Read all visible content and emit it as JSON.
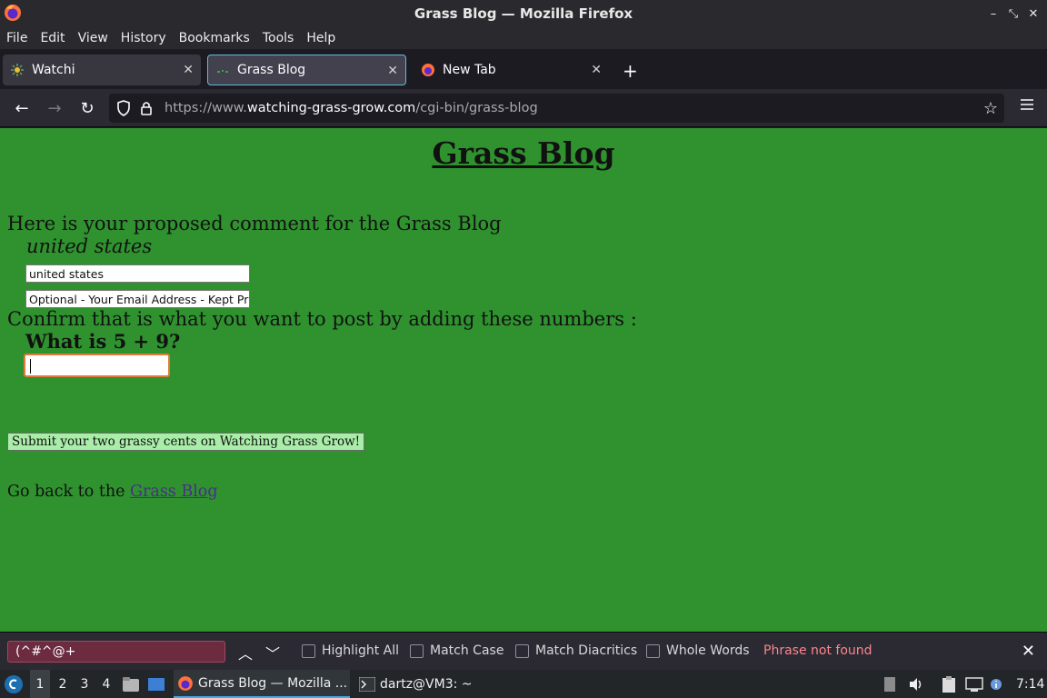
{
  "window": {
    "title": "Grass Blog — Mozilla Firefox"
  },
  "menu": [
    "File",
    "Edit",
    "View",
    "History",
    "Bookmarks",
    "Tools",
    "Help"
  ],
  "tabs": [
    {
      "label": "Watchi"
    },
    {
      "label": "Grass Blog"
    },
    {
      "label": "New Tab"
    }
  ],
  "urlbar": {
    "prefix": "https://www.",
    "domain": "watching-grass-grow.com",
    "path": "/cgi-bin/grass-blog"
  },
  "page": {
    "heading": "Grass Blog",
    "intro": "Here is your proposed comment for the Grass Blog",
    "comment": "united states",
    "name_field_value": "united states",
    "email_field_value": "Optional - Your Email Address - Kept Private",
    "confirm": "Confirm that is what you want to post by adding these numbers :",
    "question": "What is 5 + 9?",
    "answer_value": "",
    "submit_label": "Submit your two grassy cents on Watching Grass Grow!",
    "goback_text": "Go back to the ",
    "goback_link": "Grass Blog"
  },
  "findbar": {
    "query": "(^#^@+",
    "options": [
      "Highlight All",
      "Match Case",
      "Match Diacritics",
      "Whole Words"
    ],
    "status": "Phrase not found"
  },
  "taskbar": {
    "desktops": [
      "1",
      "2",
      "3",
      "4"
    ],
    "firefox_task": "Grass Blog — Mozilla ...",
    "terminal_task": "dartz@VM3: ~",
    "clock": "7:14"
  },
  "colors": {
    "page_background": "#2f922f",
    "submit_background": "#a9eda9",
    "find_input_background": "#6d2b40",
    "not_found_text": "#ff848b"
  }
}
